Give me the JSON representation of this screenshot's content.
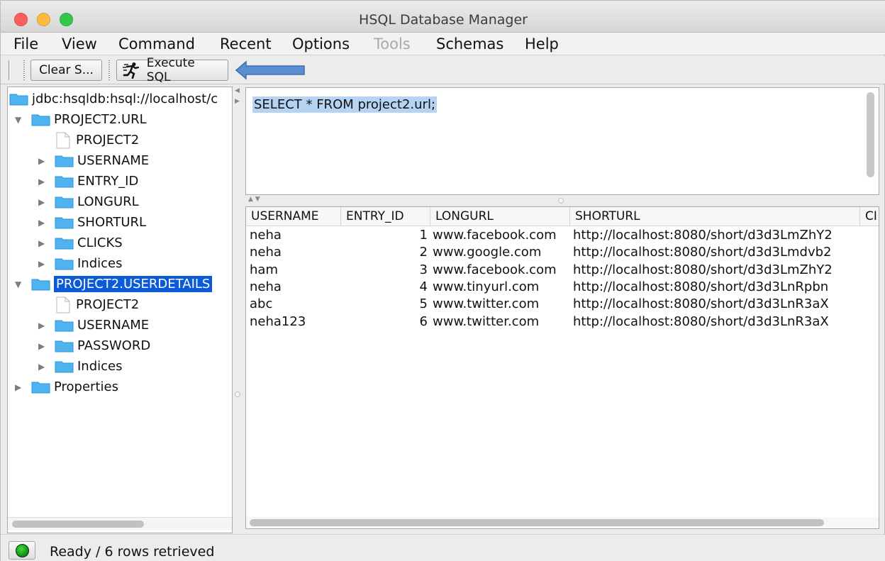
{
  "window": {
    "title": "HSQL Database Manager"
  },
  "menu": [
    "File",
    "View",
    "Command",
    "Recent",
    "Options",
    "Tools",
    "Schemas",
    "Help"
  ],
  "menu_disabled": [
    "Tools"
  ],
  "toolbar": {
    "clear_label": "Clear S...",
    "execute_label": "Execute SQL",
    "execute_icon": "runner-icon",
    "annotation_arrow_color": "#5b8fd1"
  },
  "tree": {
    "connection": "jdbc:hsqldb:hsql://localhost/c",
    "tables": [
      {
        "name": "PROJECT2.URL",
        "schema_leaf": "PROJECT2",
        "columns": [
          "USERNAME",
          "ENTRY_ID",
          "LONGURL",
          "SHORTURL",
          "CLICKS",
          "Indices"
        ]
      },
      {
        "name": "PROJECT2.USERDETAILS",
        "schema_leaf": "PROJECT2",
        "columns": [
          "USERNAME",
          "PASSWORD",
          "Indices"
        ],
        "selected": true
      }
    ],
    "properties": "Properties"
  },
  "sql": {
    "query": "SELECT * FROM project2.url;"
  },
  "results": {
    "columns": [
      "USERNAME",
      "ENTRY_ID",
      "LONGURL",
      "SHORTURL",
      "CI"
    ],
    "rows": [
      [
        "neha",
        "1",
        "www.facebook.com",
        "http://localhost:8080/short/d3d3LmZhY2"
      ],
      [
        "neha",
        "2",
        "www.google.com",
        "http://localhost:8080/short/d3d3Lmdvb2"
      ],
      [
        "ham",
        "3",
        "www.facebook.com",
        "http://localhost:8080/short/d3d3LmZhY2"
      ],
      [
        "neha",
        "4",
        "www.tinyurl.com",
        "http://localhost:8080/short/d3d3LnRpbn"
      ],
      [
        "abc",
        "5",
        "www.twitter.com",
        "http://localhost:8080/short/d3d3LnR3aX"
      ],
      [
        "neha123",
        "6",
        "www.twitter.com",
        "http://localhost:8080/short/d3d3LnR3aX"
      ]
    ]
  },
  "status": {
    "text": "Ready / 6 rows retrieved",
    "light_color": "#1db01d"
  },
  "colors": {
    "selection": "#0b5ad9",
    "sql_highlight": "#b5d3f3",
    "folder": "#4fb3f0"
  }
}
